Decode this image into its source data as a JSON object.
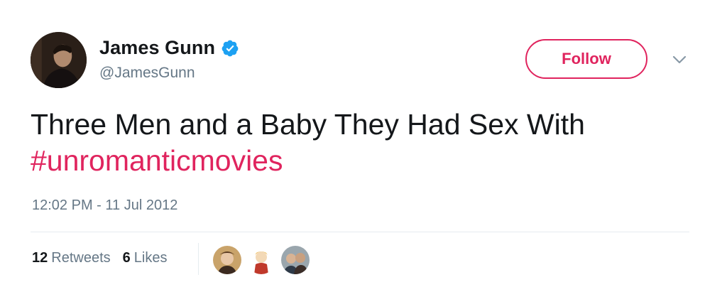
{
  "user": {
    "display_name": "James Gunn",
    "handle": "@JamesGunn",
    "verified": true,
    "avatar_icon": "profile-photo"
  },
  "actions": {
    "follow_label": "Follow",
    "menu_icon": "chevron-down-icon"
  },
  "tweet": {
    "text": "Three Men and a Baby They Had Sex With",
    "hashtag": "#unromanticmovies",
    "timestamp": "12:02 PM - 11 Jul 2012"
  },
  "stats": {
    "retweets_count": "12",
    "retweets_label": "Retweets",
    "likes_count": "6",
    "likes_label": "Likes"
  },
  "liked_by_avatars": [
    "liker-avatar-1",
    "liker-avatar-2",
    "liker-avatar-3"
  ],
  "colors": {
    "accent": "#e0245e",
    "text": "#14171a",
    "secondary": "#657786",
    "verified": "#1da1f2",
    "divider": "#e6ecf0"
  }
}
